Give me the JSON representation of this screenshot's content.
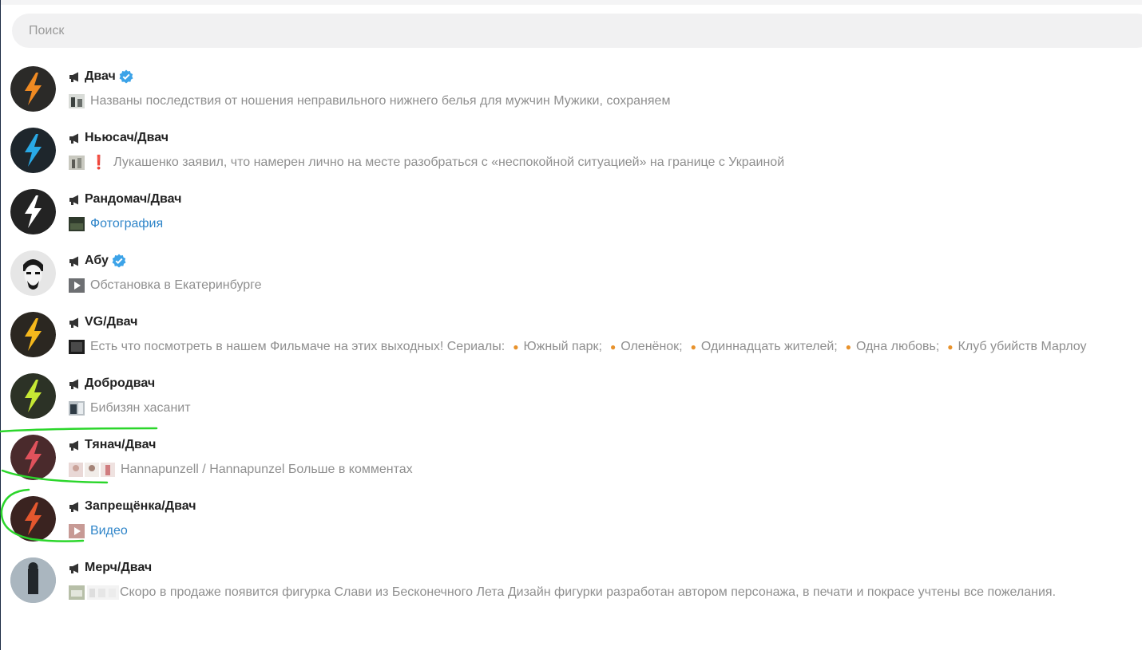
{
  "search": {
    "placeholder": "Поиск"
  },
  "chats": [
    {
      "title": "Двач",
      "verified": true,
      "preview": "Названы последствия от ношения неправильного нижнего белья для мужчин  Мужики, сохраняем",
      "preview_type": "text"
    },
    {
      "title": "Ньюсач/Двач",
      "verified": false,
      "preview": "Лукашенко заявил, что намерен лично на месте разобраться с «неспокойной ситуацией» на границе с Украиной",
      "preview_type": "text"
    },
    {
      "title": "Рандомач/Двач",
      "verified": false,
      "preview": "Фотография",
      "preview_type": "media"
    },
    {
      "title": "Абу",
      "verified": true,
      "preview": "Обстановка в Екатеринбурге",
      "preview_type": "text"
    },
    {
      "title": "VG/Двач",
      "verified": false,
      "preview": "Есть что посмотреть в нашем Фильмаче на этих выходных!  Сериалы:",
      "preview_type": "text",
      "bullets": [
        "Южный парк;",
        "Оленёнок;",
        "Одиннадцать жителей;",
        "Одна любовь;",
        "Клуб убийств Марлоу"
      ]
    },
    {
      "title": "Добродвач",
      "verified": false,
      "preview": "Бибизян хасанит",
      "preview_type": "text"
    },
    {
      "title": "Тянач/Двач",
      "verified": false,
      "preview": "Hannapunzell / Hannapunzel  Больше в комментах",
      "preview_type": "text"
    },
    {
      "title": "Запрещёнка/Двач",
      "verified": false,
      "preview": "Видео",
      "preview_type": "media"
    },
    {
      "title": "Мерч/Двач",
      "verified": false,
      "preview": "Скоро в продаже появится фигурка Слави из Бесконечного Лета   Дизайн фигурки разработан автором персонажа, в печати и покрасе учтены все пожелания.",
      "preview_type": "text"
    }
  ],
  "colors": {
    "accent_link": "#2f85c9",
    "preview_text": "#8f8f8f",
    "verified": "#3ca3e8",
    "annotation": "#2bd62b",
    "bullet": "#e8922c"
  }
}
